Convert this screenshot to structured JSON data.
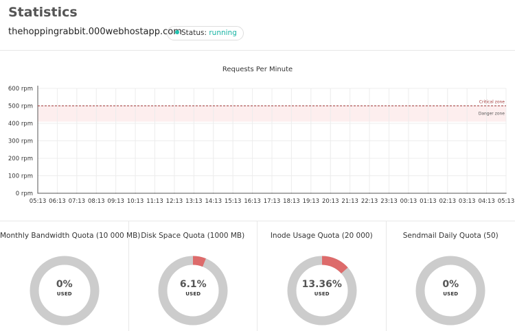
{
  "header": {
    "title": "Statistics",
    "site": "thehoppingrabbit.000webhostapp.com",
    "status_label": "Status:",
    "status_value": "running",
    "status_color": "#22c2b0"
  },
  "chart_data": {
    "type": "line",
    "title": "Requests Per Minute",
    "y_ticks": [
      "600 rpm",
      "500 rpm",
      "400 rpm",
      "300 rpm",
      "200 rpm",
      "100 rpm",
      "0 rpm"
    ],
    "y_tick_values": [
      600,
      500,
      400,
      300,
      200,
      100,
      0
    ],
    "ylim": [
      0,
      600
    ],
    "x": [
      "05:13",
      "06:13",
      "07:13",
      "08:13",
      "09:13",
      "10:13",
      "11:13",
      "12:13",
      "13:13",
      "14:13",
      "15:13",
      "16:13",
      "17:13",
      "18:13",
      "19:13",
      "20:13",
      "21:13",
      "22:13",
      "23:13",
      "00:13",
      "01:13",
      "02:13",
      "03:13",
      "04:13",
      "05:13"
    ],
    "series": [
      {
        "values": [
          0,
          0,
          0,
          0,
          0,
          0,
          0,
          0,
          0,
          0,
          0,
          0,
          0,
          0,
          0,
          0,
          0,
          0,
          0,
          0,
          0,
          0,
          0,
          0,
          0
        ]
      }
    ],
    "critical_zone": {
      "label": "Critical zone",
      "value": 500,
      "color": "#a33a3a"
    },
    "danger_zone": {
      "label": "Danger zone",
      "from": 410,
      "to": 500,
      "color": "#fdeeee"
    },
    "grid": true
  },
  "quotas": [
    {
      "title": "Monthly Bandwidth Quota (10 000 MB)",
      "value": "0%",
      "used_label": "USED",
      "percent": 0
    },
    {
      "title": "Disk Space Quota (1000 MB)",
      "value": "6.1%",
      "used_label": "USED",
      "percent": 6.1
    },
    {
      "title": "Inode Usage Quota (20 000)",
      "value": "13.36%",
      "used_label": "USED",
      "percent": 13.36
    },
    {
      "title": "Sendmail Daily Quota (50)",
      "value": "0%",
      "used_label": "USED",
      "percent": 0
    }
  ],
  "colors": {
    "ring_track": "#cccccc",
    "ring_used": "#dd6b6b"
  }
}
